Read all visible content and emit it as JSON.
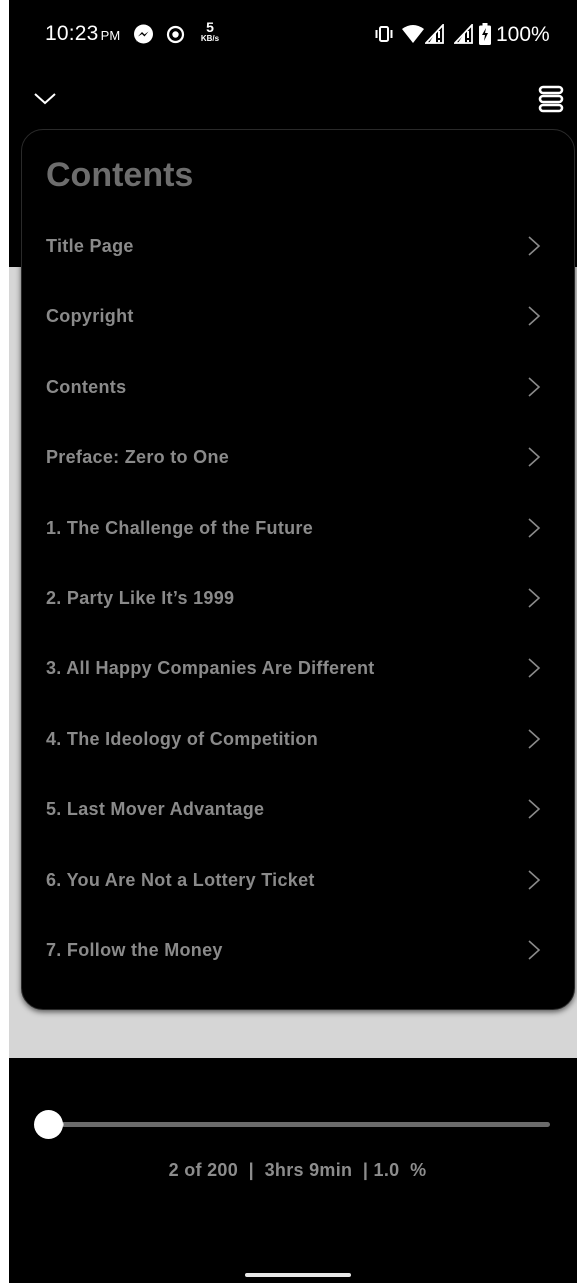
{
  "status_bar": {
    "time": "10:23",
    "ampm": "PM",
    "net_speed_value": "5",
    "net_speed_unit": "KB/s",
    "battery": "100%",
    "icons": [
      "messenger-icon",
      "record-icon",
      "vibrate-icon",
      "wifi-icon",
      "signal-icon",
      "signal-icon",
      "battery-charging-icon"
    ]
  },
  "top_bar": {
    "left_icon": "chevron-down-icon",
    "right_icon": "menu-stack-icon"
  },
  "contents": {
    "title": "Contents",
    "items": [
      {
        "label": "Title Page"
      },
      {
        "label": "Copyright"
      },
      {
        "label": "Contents"
      },
      {
        "label": "Preface: Zero to One"
      },
      {
        "label": "1. The Challenge of the Future"
      },
      {
        "label": "2. Party Like It’s 1999"
      },
      {
        "label": "3. All Happy Companies Are Different"
      },
      {
        "label": "4. The Ideology of Competition"
      },
      {
        "label": "5. Last Mover Advantage"
      },
      {
        "label": "6. You Are Not a Lottery Ticket"
      },
      {
        "label": "7. Follow the Money"
      }
    ]
  },
  "progress": {
    "fraction": 0.01,
    "info": "2 of 200  |  3hrs 9min  | 1.0  %"
  },
  "colors": {
    "background": "#000000",
    "text_muted": "#8a8a8a",
    "title": "#6d6d6d",
    "page_grey": "#d6d6d6"
  }
}
